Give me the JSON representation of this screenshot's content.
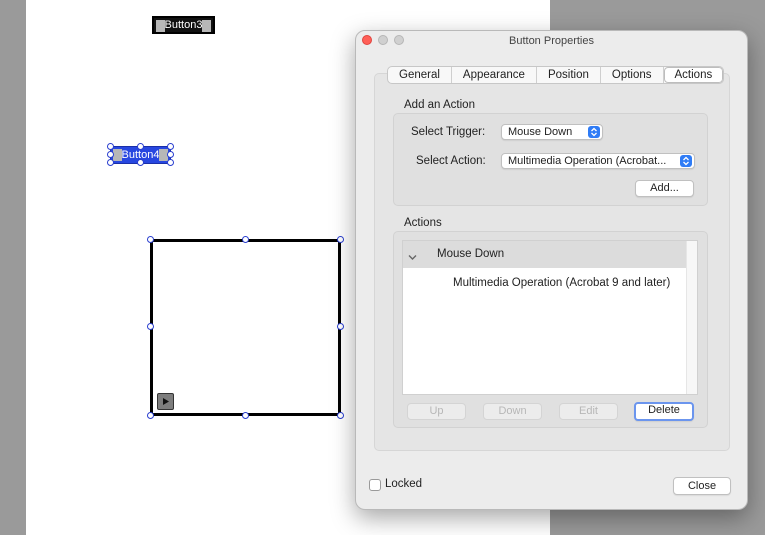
{
  "document": {
    "field_button_3": "Button3",
    "field_button_4": "Button4"
  },
  "dialog": {
    "title": "Button Properties",
    "tabs": [
      {
        "label": "General"
      },
      {
        "label": "Appearance"
      },
      {
        "label": "Position"
      },
      {
        "label": "Options"
      },
      {
        "label": "Actions"
      }
    ],
    "active_tab": "Actions",
    "add_action": {
      "section_label": "Add an Action",
      "trigger_label": "Select Trigger:",
      "trigger_value": "Mouse Down",
      "action_label": "Select Action:",
      "action_value": "Multimedia Operation (Acrobat...",
      "add_button": "Add..."
    },
    "actions": {
      "section_label": "Actions",
      "group_label": "Mouse Down",
      "item": "Multimedia Operation (Acrobat 9 and later)",
      "buttons": {
        "up": "Up",
        "down": "Down",
        "edit": "Edit",
        "delete": "Delete"
      }
    },
    "locked_label": "Locked",
    "locked_checked": false,
    "close_button": "Close"
  },
  "colors": {
    "accent": "#2f7cf6",
    "selection_blue": "#2747e0",
    "focus_ring": "#6b95ee"
  }
}
